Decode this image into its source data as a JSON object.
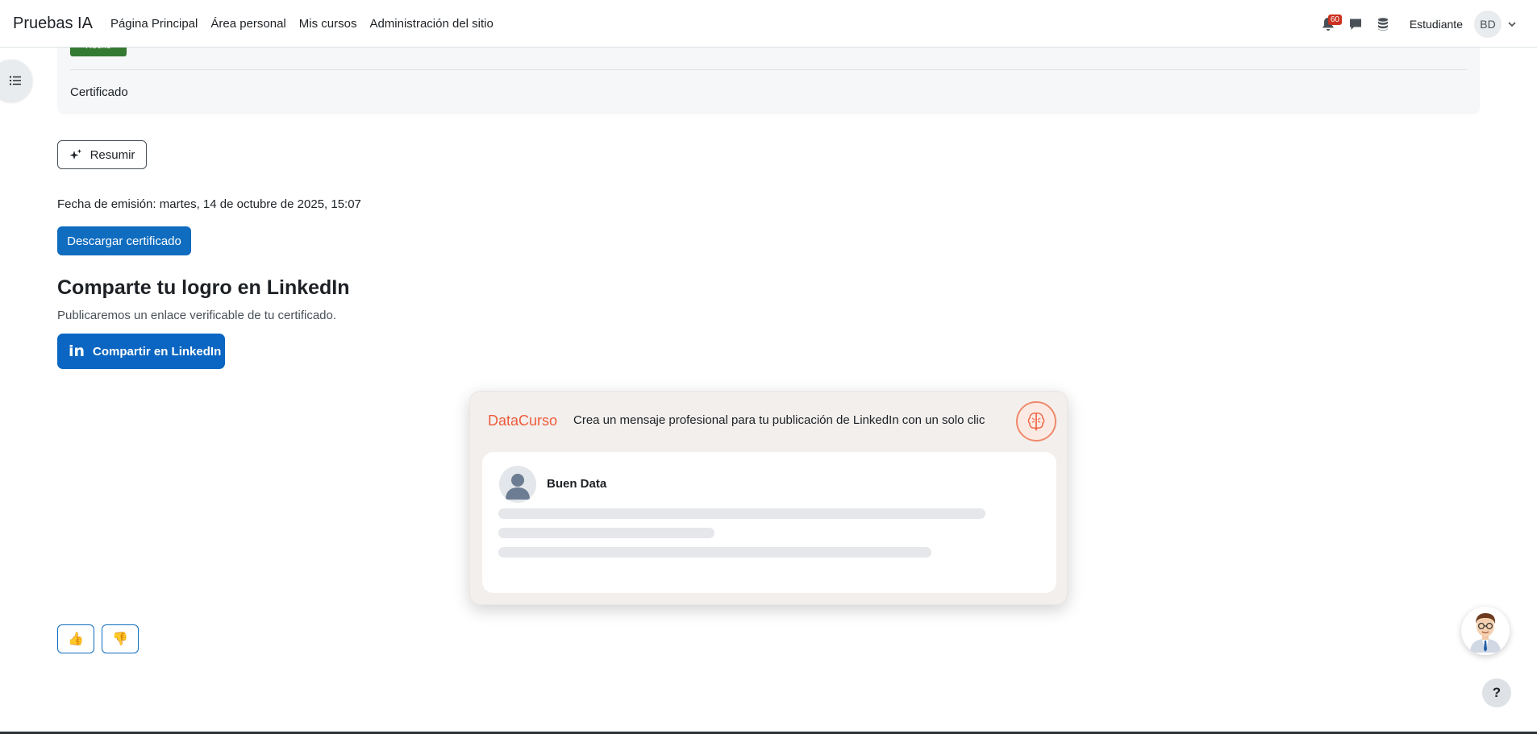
{
  "navbar": {
    "brand": "Pruebas IA",
    "links": [
      "Página Principal",
      "Área personal",
      "Mis cursos",
      "Administración del sitio"
    ],
    "notification_count": "60",
    "role": "Estudiante",
    "avatar_initials": "BD"
  },
  "course_card": {
    "status_badge": "Hecho",
    "activity_label": "Certificado"
  },
  "resumir_label": "Resumir",
  "issue_date": "Fecha de emisión: martes, 14 de octubre de 2025, 15:07",
  "download_label": "Descargar certificado",
  "share": {
    "heading": "Comparte tu logro en LinkedIn",
    "subtitle": "Publicaremos un enlace verificable de tu certificado.",
    "button_label": "Compartir en LinkedIn"
  },
  "datacurso": {
    "brand": "DataCurso",
    "tagline": "Crea un mensaje profesional para tu publicación de LinkedIn con un solo clic",
    "username": "Buen Data"
  },
  "feedback": {
    "thumbs_up": "👍",
    "thumbs_down": "👎"
  },
  "help_label": "?",
  "colors": {
    "primary": "#0f6cbf",
    "linkedin": "#0a66c2",
    "success": "#357a32",
    "badge": "#ca3120",
    "datacurso_accent": "#ef5b3b"
  },
  "icons": [
    "list-icon",
    "bell-icon",
    "chat-icon",
    "database-icon",
    "chevron-down-icon",
    "sparkle-icon",
    "linkedin-icon",
    "brain-icon",
    "user-icon",
    "assistant-avatar-icon"
  ]
}
